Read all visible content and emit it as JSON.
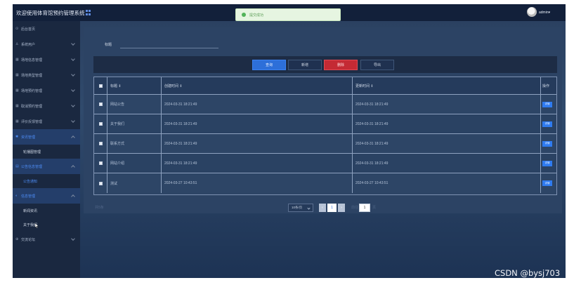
{
  "header": {
    "title": "欢迎使用体育馆预约管理系统",
    "toast": "提交成功",
    "user": "admin"
  },
  "sidebar": {
    "items": [
      {
        "label": "后台首页",
        "icon": "home-icon"
      },
      {
        "label": "系统用户",
        "icon": "user-icon"
      },
      {
        "label": "场地信息管理",
        "icon": "grid-icon"
      },
      {
        "label": "场地类型管理",
        "icon": "grid-icon"
      },
      {
        "label": "场地预约管理",
        "icon": "grid-icon"
      },
      {
        "label": "取消预约管理",
        "icon": "grid-icon"
      },
      {
        "label": "评价反馈管理",
        "icon": "grid-icon"
      },
      {
        "label": "资讯管理",
        "icon": "gear-icon"
      },
      {
        "label": "轮播图管理",
        "icon": ""
      },
      {
        "label": "公告信息管理",
        "icon": "document-icon"
      },
      {
        "label": "公告通知",
        "icon": ""
      },
      {
        "label": "信息管理",
        "icon": "info-icon"
      },
      {
        "label": "新闻资讯",
        "icon": ""
      },
      {
        "label": "关于我们",
        "icon": ""
      },
      {
        "label": "交流论坛",
        "icon": "chat-icon"
      }
    ]
  },
  "search": {
    "label": "标题",
    "value": ""
  },
  "toolbar": {
    "query": "查询",
    "add": "新增",
    "delete": "删除",
    "export": "导出"
  },
  "table": {
    "headers": [
      "标题 ⇕",
      "创建时间 ⇕",
      "更新时间 ⇕",
      "操作"
    ],
    "detail_label": "详情",
    "rows": [
      {
        "title": "网站公告",
        "created": "2024-03-31 18:21:49",
        "updated": "2024-03-31 18:21:49"
      },
      {
        "title": "关于我们",
        "created": "2024-03-31 18:21:49",
        "updated": "2024-03-31 18:21:49"
      },
      {
        "title": "联系方式",
        "created": "2024-03-31 18:21:49",
        "updated": "2024-03-31 18:21:49"
      },
      {
        "title": "网站介绍",
        "created": "2024-03-31 18:21:49",
        "updated": "2024-03-31 18:21:49"
      },
      {
        "title": "测试",
        "created": "2024-03-27 10:43:51",
        "updated": "2024-03-27 10:43:51"
      }
    ]
  },
  "pagination": {
    "total": "共5条",
    "page_size": "10条/页",
    "current_page": "1",
    "goto_prefix": "前往",
    "goto_value": "1",
    "goto_suffix": "页"
  },
  "watermark": "CSDN @bysj703"
}
